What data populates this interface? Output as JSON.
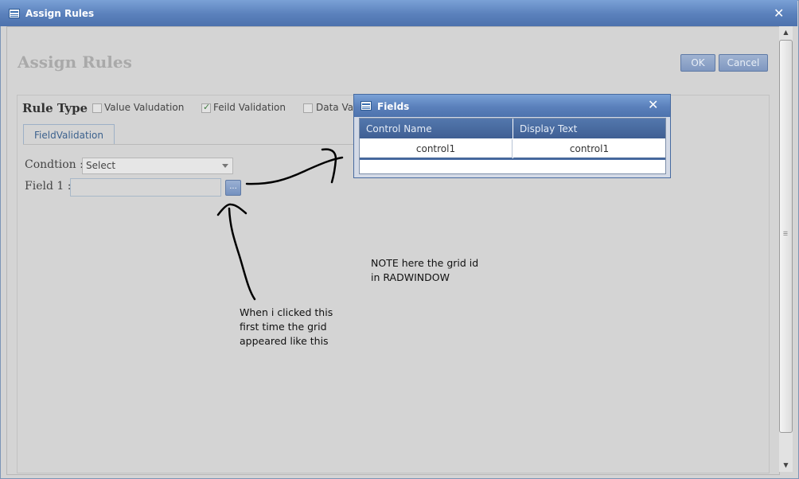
{
  "window": {
    "title": "Assign Rules",
    "close_glyph": "✕",
    "icon": "window-icon"
  },
  "page": {
    "title": "Assign Rules",
    "ok_label": "OK",
    "cancel_label": "Cancel"
  },
  "rule_type": {
    "label": "Rule Type :",
    "options": [
      {
        "label": "Value Valudation",
        "checked": false
      },
      {
        "label": "Feild Validation",
        "checked": true
      },
      {
        "label": "Data Vali",
        "checked": false
      }
    ]
  },
  "tabs": [
    {
      "label": "FieldValidation",
      "selected": true
    }
  ],
  "form": {
    "condition_label": "Condtion :",
    "condition_value": "Select",
    "field1_label": "Field 1 :",
    "field1_value": "",
    "ellipsis_label": "..."
  },
  "fields_popup": {
    "title": "Fields",
    "close_glyph": "✕",
    "columns": [
      "Control Name",
      "Display Text"
    ],
    "rows": [
      [
        "control1",
        "control1"
      ]
    ]
  },
  "annotations": {
    "note": [
      "NOTE here the grid id",
      "in RADWINDOW"
    ],
    "click_note": [
      "When i clicked this",
      "first time the grid",
      "appeared like this"
    ]
  },
  "colors": {
    "titlebar": "#5a80bb",
    "background": "#d4d4d4",
    "grid_header": "#4a6da3"
  }
}
